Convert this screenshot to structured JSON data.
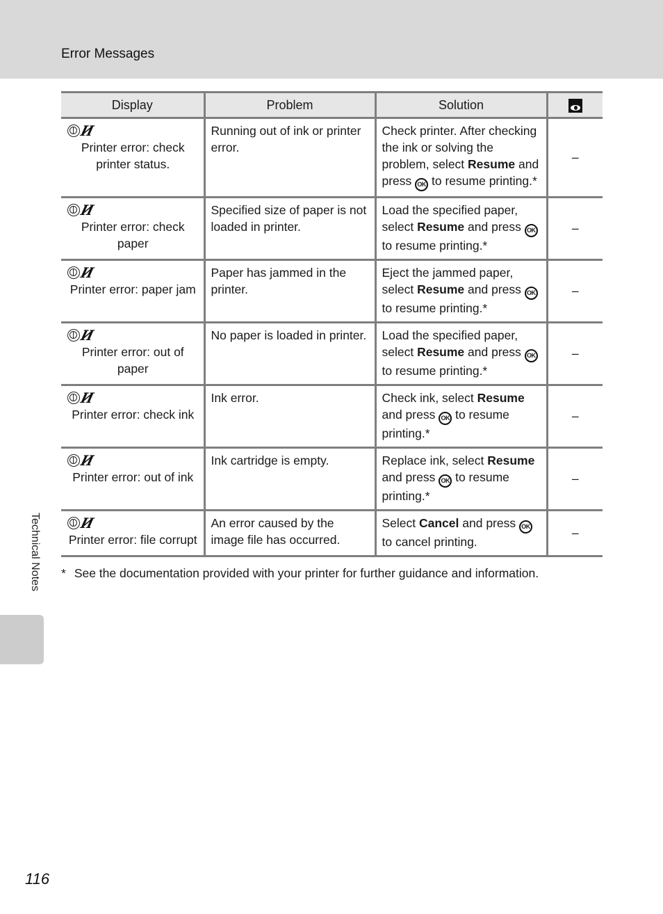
{
  "header": {
    "title": "Error Messages"
  },
  "table": {
    "columns": [
      "Display",
      "Problem",
      "Solution",
      "reference-icon"
    ],
    "rows": [
      {
        "display": "Printer error: check printer status.",
        "problem": "Running out of ink or printer error.",
        "solution": {
          "pre": "Check printer. After checking the ink or solving the problem, select ",
          "bold": "Resume",
          "mid": " and press ",
          "button": "OK",
          "post": " to resume printing.*"
        },
        "reference": "–"
      },
      {
        "display": "Printer error: check paper",
        "problem": "Specified size of paper is not loaded in printer.",
        "solution": {
          "pre": "Load the specified paper, select ",
          "bold": "Resume",
          "mid": " and press ",
          "button": "OK",
          "post": " to resume printing.*"
        },
        "reference": "–"
      },
      {
        "display": "Printer error: paper jam",
        "problem": "Paper has jammed in the printer.",
        "solution": {
          "pre": "Eject the jammed paper, select ",
          "bold": "Resume",
          "mid": " and press ",
          "button": "OK",
          "post": " to resume printing.*"
        },
        "reference": "–"
      },
      {
        "display": "Printer error: out of paper",
        "problem": "No paper is loaded in printer.",
        "solution": {
          "pre": "Load the specified paper, select ",
          "bold": "Resume",
          "mid": " and press ",
          "button": "OK",
          "post": " to resume printing.*"
        },
        "reference": "–"
      },
      {
        "display": "Printer error: check ink",
        "problem": "Ink error.",
        "solution": {
          "pre": "Check ink, select ",
          "bold": "Resume",
          "mid": " and press ",
          "button": "OK",
          "post": " to resume printing.*"
        },
        "reference": "–"
      },
      {
        "display": "Printer error: out of ink",
        "problem": "Ink cartridge is empty.",
        "solution": {
          "pre": "Replace ink, select ",
          "bold": "Resume",
          "mid": " and press ",
          "button": "OK",
          "post": " to resume printing.*"
        },
        "reference": "–"
      },
      {
        "display": "Printer error: file corrupt",
        "problem": "An error caused by the image file has occurred.",
        "solution": {
          "pre": "Select ",
          "bold": "Cancel",
          "mid": " and press ",
          "button": "OK",
          "post": " to cancel printing."
        },
        "reference": "–"
      }
    ]
  },
  "icons": {
    "display": [
      "printer-icon",
      "ink-icon"
    ],
    "ink_glyph": "✂",
    "header_ref": "reference-icon"
  },
  "footnote": {
    "marker": "*",
    "text": "See the documentation provided with your printer for further guidance and information."
  },
  "side_tab": {
    "label": "Technical Notes"
  },
  "page_number": "116"
}
